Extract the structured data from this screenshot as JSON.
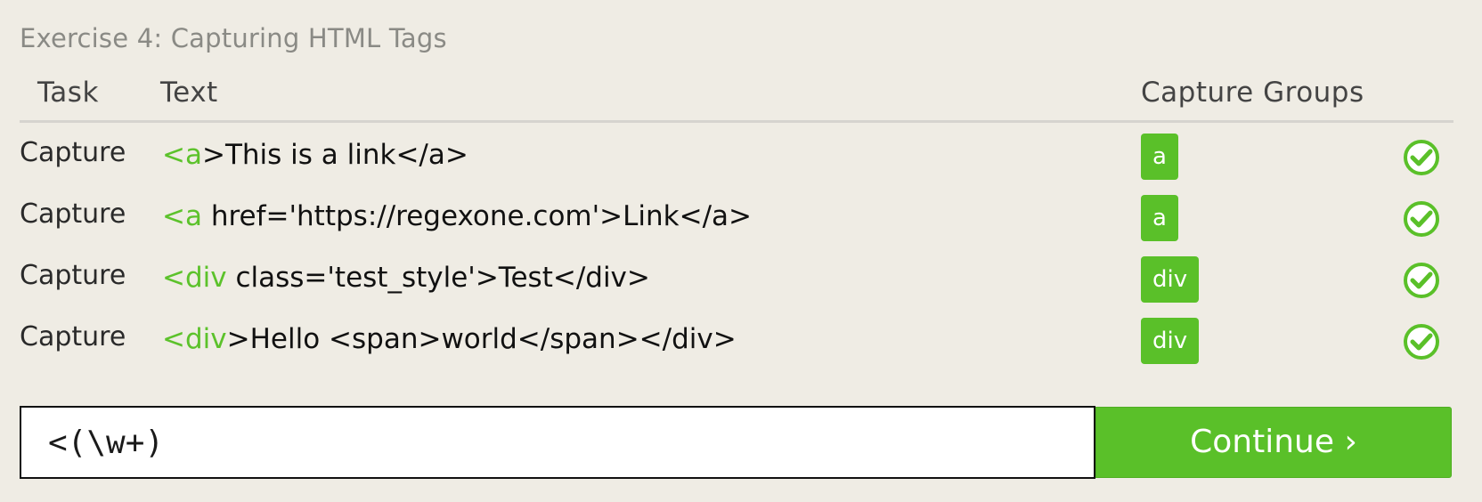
{
  "exercise": {
    "title": "Exercise 4: Capturing HTML Tags"
  },
  "table": {
    "headers": {
      "task": "Task",
      "text": "Text",
      "groups": "Capture Groups"
    },
    "rows": [
      {
        "task": "Capture",
        "text_hl": "<a",
        "text_rest": ">This is a link</a>",
        "group": "a",
        "status": "check-icon"
      },
      {
        "task": "Capture",
        "text_hl": "<a",
        "text_rest": " href='https://regexone.com'>Link</a>",
        "group": "a",
        "status": "check-icon"
      },
      {
        "task": "Capture",
        "text_hl": "<div",
        "text_rest": " class='test_style'>Test</div>",
        "group": "div",
        "status": "check-icon"
      },
      {
        "task": "Capture",
        "text_hl": "<div",
        "text_rest": ">Hello <span>world</span></div>",
        "group": "div",
        "status": "check-icon"
      }
    ]
  },
  "answer": {
    "value": "<(\\w+)"
  },
  "continue_label": "Continue ›",
  "colors": {
    "accent": "#5ac029",
    "background": "#efece4",
    "highlight": "#5cc22b"
  }
}
